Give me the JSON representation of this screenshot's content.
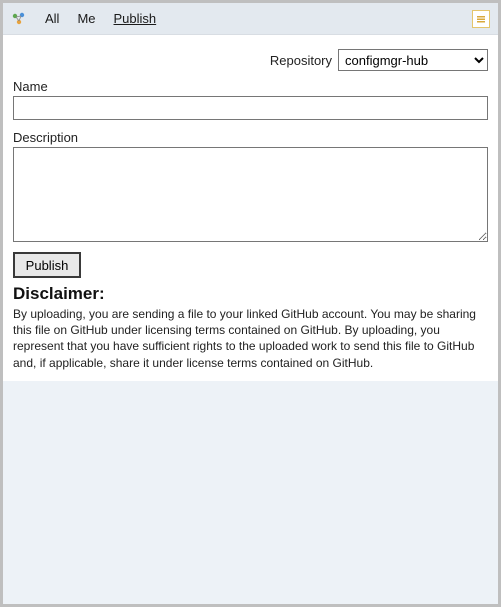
{
  "toolbar": {
    "tabs": {
      "all": "All",
      "me": "Me",
      "publish": "Publish"
    },
    "active_tab": "publish"
  },
  "form": {
    "repository_label": "Repository",
    "repository_value": "configmgr-hub",
    "name_label": "Name",
    "name_value": "",
    "description_label": "Description",
    "description_value": "",
    "publish_button": "Publish"
  },
  "disclaimer": {
    "title": "Disclaimer:",
    "text": "By uploading, you are sending a file to your linked GitHub account. You may be sharing this file on GitHub under licensing terms contained on GitHub. By uploading, you represent that you have sufficient rights to the uploaded work to send this file to GitHub and, if applicable, share it under license terms contained on GitHub."
  }
}
